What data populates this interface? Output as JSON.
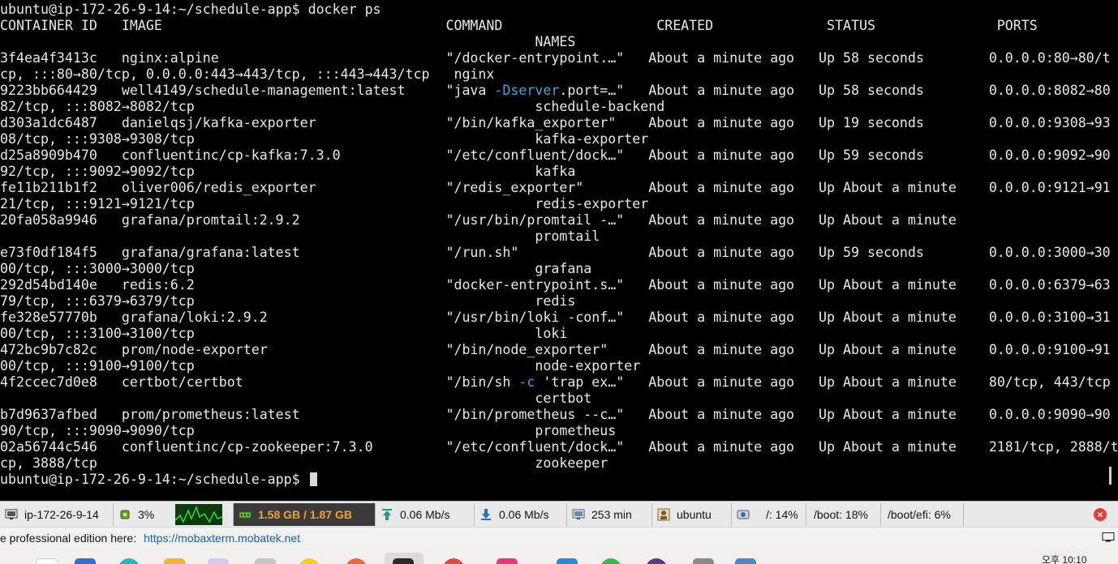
{
  "terminal": {
    "lines": [
      [
        {
          "t": "ubuntu@ip-172-26-9-14:~/schedule-app$ docker ps"
        }
      ],
      [
        {
          "t": "CONTAINER ID   IMAGE                                   COMMAND                   CREATED              STATUS               PORTS"
        }
      ],
      [
        {
          "t": "                                                                  NAMES"
        }
      ],
      [
        {
          "t": "3f4ea4f3413c   nginx:alpine                            \"/docker-entrypoint.…\"   About a minute ago   Up 58 seconds        0.0.0.0:80→80/t"
        }
      ],
      [
        {
          "t": "cp, :::80→80/tcp, 0.0.0.0:443→443/tcp, :::443→443/tcp   nginx"
        }
      ],
      [
        {
          "t": "9223bb664429   well4149/schedule-management:latest     \"java "
        },
        {
          "t": "-Dserver",
          "c": "flag"
        },
        {
          "t": ".port=…\"   About a minute ago   Up 58 seconds        0.0.0.0:8082→80"
        }
      ],
      [
        {
          "t": "82/tcp, :::8082→8082/tcp                                          schedule-backend"
        }
      ],
      [
        {
          "t": "d303a1dc6487   danielqsj/kafka-exporter                \"/bin/kafka_exporter\"    About a minute ago   Up 19 seconds        0.0.0.0:9308→93"
        }
      ],
      [
        {
          "t": "08/tcp, :::9308→9308/tcp                                          kafka-exporter"
        }
      ],
      [
        {
          "t": "d25a8909b470   confluentinc/cp-kafka:7.3.0             \"/etc/confluent/dock…\"   About a minute ago   Up 59 seconds        0.0.0.0:9092→90"
        }
      ],
      [
        {
          "t": "92/tcp, :::9092→9092/tcp                                          kafka"
        }
      ],
      [
        {
          "t": "fe11b211b1f2   oliver006/redis_exporter                \"/redis_exporter\"        About a minute ago   Up About a minute    0.0.0.0:9121→91"
        }
      ],
      [
        {
          "t": "21/tcp, :::9121→9121/tcp                                          redis-exporter"
        }
      ],
      [
        {
          "t": "20fa058a9946   grafana/promtail:2.9.2                  \"/usr/bin/promtail -…\"   About a minute ago   Up About a minute"
        }
      ],
      [
        {
          "t": "                                                                  promtail"
        }
      ],
      [
        {
          "t": "e73f0df184f5   grafana/grafana:latest                  \"/run.sh\"                About a minute ago   Up 59 seconds        0.0.0.0:3000→30"
        }
      ],
      [
        {
          "t": "00/tcp, :::3000→3000/tcp                                          grafana"
        }
      ],
      [
        {
          "t": "292d54bd140e   redis:6.2                               \"docker-entrypoint.s…\"   About a minute ago   Up About a minute    0.0.0.0:6379→63"
        }
      ],
      [
        {
          "t": "79/tcp, :::6379→6379/tcp                                          redis"
        }
      ],
      [
        {
          "t": "fe328e57770b   grafana/loki:2.9.2                      \"/usr/bin/loki -conf…\"   About a minute ago   Up About a minute    0.0.0.0:3100→31"
        }
      ],
      [
        {
          "t": "00/tcp, :::3100→3100/tcp                                          loki"
        }
      ],
      [
        {
          "t": "472bc9b7c82c   prom/node-exporter                      \"/bin/node_exporter\"     About a minute ago   Up About a minute    0.0.0.0:9100→91"
        }
      ],
      [
        {
          "t": "00/tcp, :::9100→9100/tcp                                          node-exporter"
        }
      ],
      [
        {
          "t": "4f2ccec7d0e8   certbot/certbot                         \"/bin/sh "
        },
        {
          "t": "-c",
          "c": "flag"
        },
        {
          "t": " 'trap ex…\"   About a minute ago   Up About a minute    80/tcp, 443/tcp"
        }
      ],
      [
        {
          "t": "                                                                  certbot"
        }
      ],
      [
        {
          "t": "b7d9637afbed   prom/prometheus:latest                  \"/bin/prometheus --c…\"   About a minute ago   Up About a minute    0.0.0.0:9090→90"
        }
      ],
      [
        {
          "t": "90/tcp, :::9090→9090/tcp                                          prometheus"
        }
      ],
      [
        {
          "t": "02a56744c546   confluentinc/cp-zookeeper:7.3.0         \"/etc/confluent/dock…\"   About a minute ago   Up About a minute    2181/tcp, 2888/t"
        }
      ],
      [
        {
          "t": "cp, 3888/tcp                                                      zookeeper"
        }
      ],
      [
        {
          "t": "ubuntu@ip-172-26-9-14:~/schedule-app$ "
        }
      ]
    ]
  },
  "statusbar": {
    "host": "ip-172-26-9-14",
    "cpu": "3%",
    "memory": "1.58 GB / 1.87 GB",
    "upload": "0.06 Mb/s",
    "download": "0.06 Mb/s",
    "uptime": "253 min",
    "user": "ubuntu",
    "disk_root": "/: 14%",
    "disk_boot": "/boot: 18%",
    "disk_efi": "/boot/efi: 6%",
    "close_glyph": "×"
  },
  "infobar": {
    "text": "e professional edition here:",
    "link": "https://mobaxterm.mobatek.net"
  },
  "taskbar": {
    "clock_line": "오후 10:10"
  },
  "colors": {
    "terminal_bg": "#000000",
    "terminal_fg": "#e8e8e8",
    "flag": "#3fa7e0",
    "memory_text": "#f0a030",
    "link": "#1a5fb4"
  },
  "icons": [
    "monitor-icon",
    "cpu-icon",
    "cpu-graph",
    "memory-icon",
    "upload-icon",
    "download-icon",
    "uptime-icon",
    "user-icon",
    "disk-icon",
    "close-icon"
  ]
}
